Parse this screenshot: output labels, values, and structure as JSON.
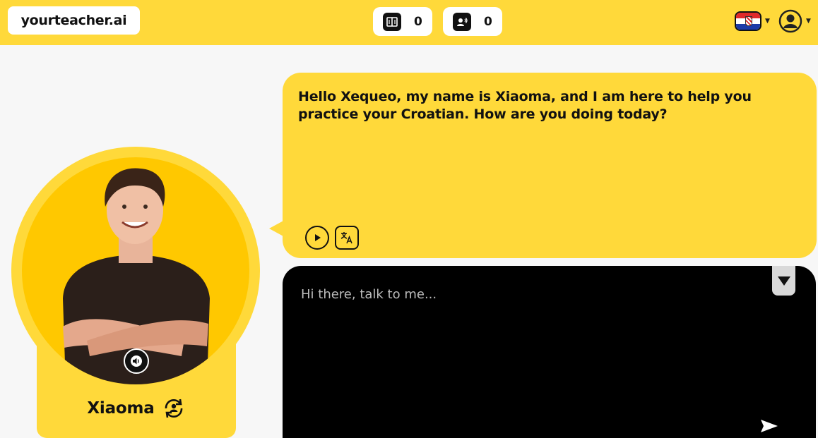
{
  "header": {
    "logo": "yourteacher.ai",
    "vocab_count": "0",
    "speaking_count": "0",
    "language_flag": "croatia-flag",
    "colors": {
      "brand_yellow": "#ffd93a",
      "dark": "#111111"
    }
  },
  "teacher": {
    "name": "Xiaoma",
    "circle_color": "#ffc800"
  },
  "chat": {
    "message": "Hello Xequeo, my name is Xiaoma, and I am here to help you practice your Croatian. How are you doing today?",
    "play_icon": "play-icon",
    "translate_icon": "translate-icon"
  },
  "input": {
    "placeholder": "Hi there, talk to me...",
    "value": ""
  }
}
